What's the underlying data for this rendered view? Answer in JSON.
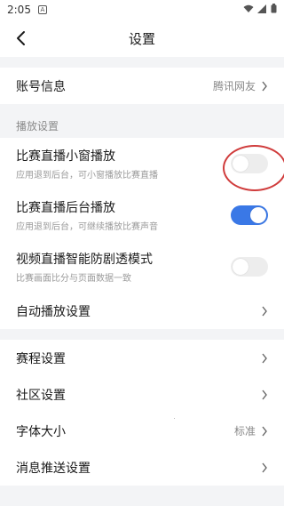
{
  "statusbar": {
    "time": "2:05",
    "notif_glyph": "A"
  },
  "navbar": {
    "title": "设置"
  },
  "account": {
    "label": "账号信息",
    "value": "腾讯网友"
  },
  "playback": {
    "section_title": "播放设置",
    "items": [
      {
        "label": "比赛直播小窗播放",
        "sub": "应用退到后台，可小窗播放比赛直播",
        "toggle": "off"
      },
      {
        "label": "比赛直播后台播放",
        "sub": "应用退到后台，可继续播放比赛声音",
        "toggle": "on"
      },
      {
        "label": "视频直播智能防剧透模式",
        "sub": "比赛画面比分与页面数据一致",
        "toggle": "off"
      }
    ],
    "autoplay": {
      "label": "自动播放设置"
    }
  },
  "general": [
    {
      "label": "赛程设置",
      "value": ""
    },
    {
      "label": "社区设置",
      "value": ""
    },
    {
      "label": "字体大小",
      "value": "标准"
    },
    {
      "label": "消息推送设置",
      "value": ""
    }
  ],
  "colors": {
    "accent": "#3a78e6",
    "annotation": "#d03c3c",
    "background": "#f3f4f6"
  }
}
